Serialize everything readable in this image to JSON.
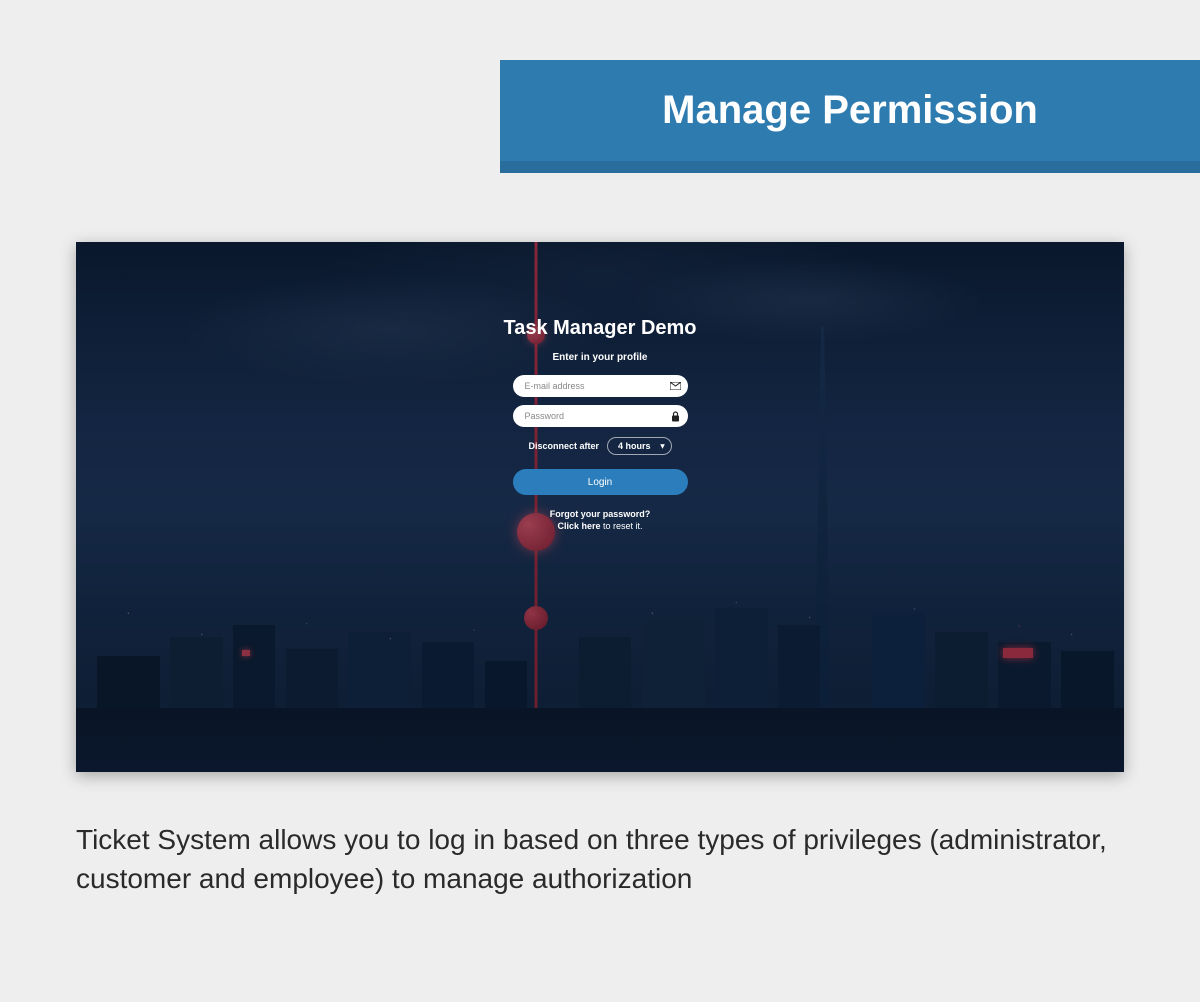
{
  "header": {
    "title": "Manage Permission"
  },
  "login": {
    "title": "Task Manager Demo",
    "subtitle": "Enter in your profile",
    "email_placeholder": "E-mail address",
    "password_placeholder": "Password",
    "disconnect_label": "Disconnect after",
    "disconnect_value": "4 hours",
    "login_button": "Login",
    "forgot_line": "Forgot your password?",
    "reset_bold": "Click here",
    "reset_rest": " to reset it."
  },
  "description": "Ticket System allows you to log in based on three types of privileges (administrator, customer and employee) to manage authorization"
}
